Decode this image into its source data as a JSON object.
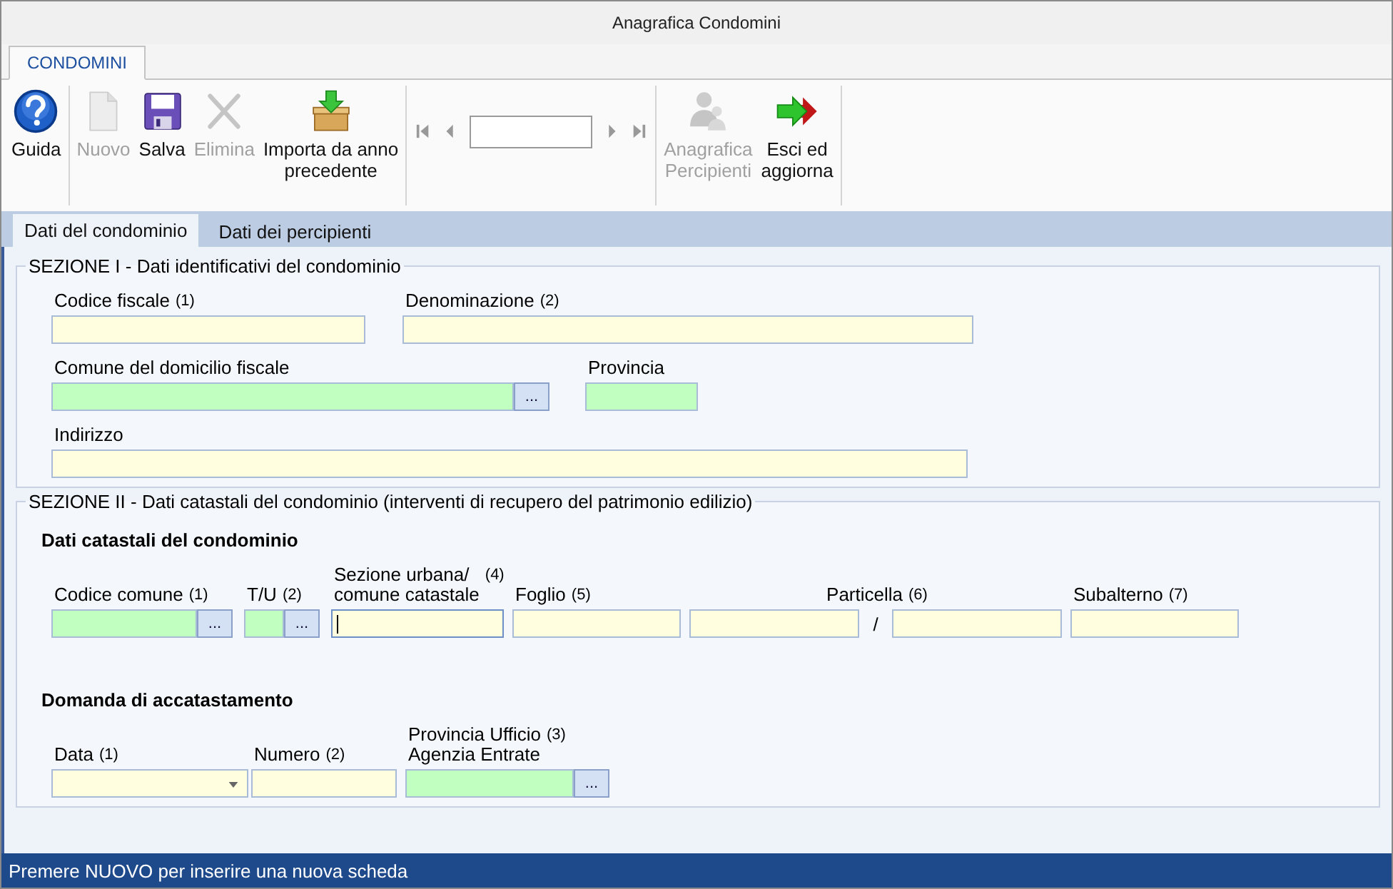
{
  "window": {
    "title": "Anagrafica Condomini"
  },
  "ribbon_tabs": [
    {
      "label": "CONDOMINI",
      "selected": true
    }
  ],
  "toolbar": [
    {
      "kind": "buttons",
      "buttons": [
        {
          "label": "Guida",
          "kind": "help",
          "disabled": false
        }
      ]
    },
    {
      "kind": "buttons",
      "buttons": [
        {
          "label": "Nuovo",
          "kind": "document",
          "disabled": true
        },
        {
          "label": "Salva",
          "kind": "floppy",
          "disabled": false
        },
        {
          "label": "Elimina",
          "kind": "cross",
          "disabled": true
        },
        {
          "label": "Importa da anno\nprecedente",
          "kind": "box",
          "disabled": false
        }
      ]
    },
    {
      "kind": "navigator"
    },
    {
      "kind": "buttons",
      "buttons": [
        {
          "label": "Anagrafica\nPercipienti",
          "kind": "people",
          "disabled": true
        },
        {
          "label": "Esci ed\naggiorna",
          "kind": "arrows",
          "disabled": false
        }
      ]
    }
  ],
  "tabs": [
    {
      "label": "Dati del condominio",
      "selected": true
    },
    {
      "label": "Dati dei percipienti",
      "selected": false
    }
  ],
  "sections": [
    {
      "title": "SEZIONE I - Dati identificativi del condominio",
      "groups": [
        {
          "rows": [
            [
              {
                "label": "Codice fiscale",
                "note": "(1)",
                "kind": "text",
                "color": "#ffffe0",
                "focused": false
              },
              {
                "label": "Denominazione",
                "note": "(2)",
                "kind": "text",
                "color": "#ffffe0",
                "focused": false
              }
            ],
            [
              {
                "label": "Comune del domicilio fiscale",
                "kind": "lookup",
                "color": "#c0ffc0",
                "button": "...",
                "focused": false
              },
              {
                "label": "Provincia",
                "kind": "text",
                "color": "#c0ffc0",
                "focused": false
              }
            ],
            [
              {
                "label": "Indirizzo",
                "kind": "text",
                "color": "#ffffe0",
                "focused": false
              }
            ]
          ]
        }
      ]
    },
    {
      "title": "SEZIONE II - Dati catastali del condominio (interventi di recupero del patrimonio edilizio)",
      "groups": [
        {
          "heading": "Dati catastali del condominio",
          "rows": [
            [
              {
                "label": "Codice comune",
                "note": "(1)",
                "kind": "lookup",
                "color": "#c0ffc0",
                "button": "...",
                "focused": false
              },
              {
                "label": "T/U",
                "note": "(2)",
                "kind": "lookup",
                "color": "#c0ffc0",
                "button": "...",
                "focused": false
              },
              {
                "label": "Sezione urbana/\ncomune catastale",
                "note": "(4)",
                "kind": "text",
                "color": "#ffffe0",
                "focused": true
              },
              {
                "label": "Foglio",
                "note": "(5)",
                "kind": "text",
                "color": "#ffffe0",
                "focused": false
              },
              {
                "label": "Particella",
                "note": "(6)",
                "kind": "split",
                "separator": "/",
                "color": "#ffffe0",
                "focused": false
              },
              {
                "label": "Subalterno",
                "note": "(7)",
                "kind": "text",
                "color": "#ffffe0",
                "focused": false
              }
            ]
          ]
        },
        {
          "heading": "Domanda di accatastamento",
          "rows": [
            [
              {
                "label": "Data",
                "note": "(1)",
                "kind": "date",
                "color": "#ffffe0",
                "focused": false
              },
              {
                "label": "Numero",
                "note": "(2)",
                "kind": "text",
                "color": "#ffffe0",
                "focused": false
              },
              {
                "label": "Provincia Ufficio\nAgenzia Entrate",
                "note": "(3)",
                "kind": "lookup",
                "color": "#c0ffc0",
                "button": "...",
                "focused": false
              }
            ]
          ]
        }
      ]
    }
  ],
  "status_bar": "Premere NUOVO per inserire una nuova scheda"
}
